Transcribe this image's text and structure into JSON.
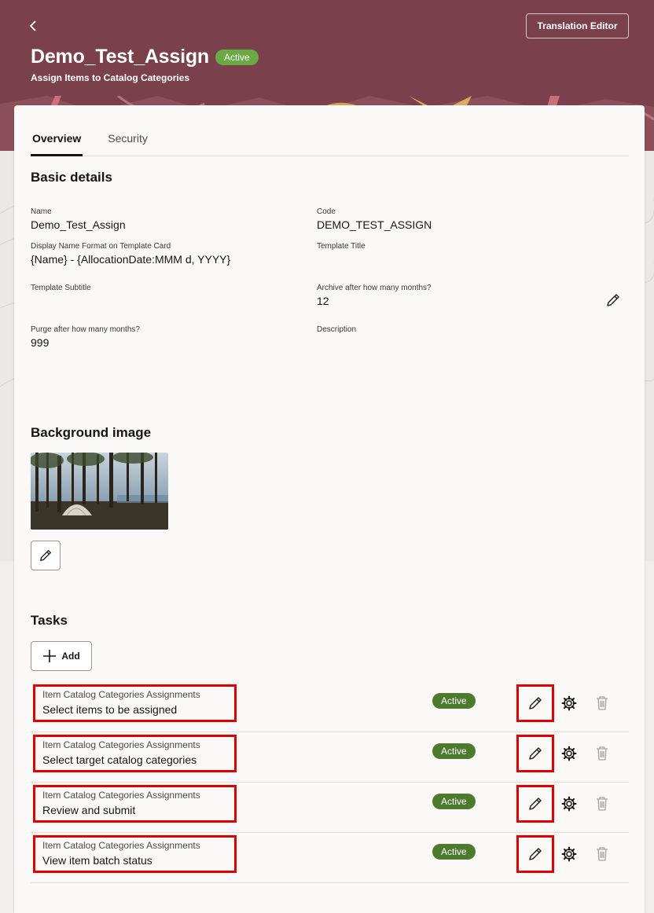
{
  "header": {
    "title": "Demo_Test_Assign",
    "status": "Active",
    "subtitle": "Assign Items to Catalog Categories",
    "translation_button": "Translation Editor",
    "back_icon": "chevron-left-icon"
  },
  "tabs": [
    {
      "label": "Overview",
      "selected": true
    },
    {
      "label": "Security",
      "selected": false
    }
  ],
  "basic_details": {
    "title": "Basic details",
    "fields": {
      "name": {
        "label": "Name",
        "value": "Demo_Test_Assign"
      },
      "code": {
        "label": "Code",
        "value": "DEMO_TEST_ASSIGN"
      },
      "display_name_format": {
        "label": "Display Name Format on Template Card",
        "value": "{Name} - {AllocationDate:MMM d, YYYY}"
      },
      "template_title": {
        "label": "Template Title",
        "value": ""
      },
      "template_subtitle": {
        "label": "Template Subtitle",
        "value": ""
      },
      "archive_months": {
        "label": "Archive after how many months?",
        "value": "12"
      },
      "purge_months": {
        "label": "Purge after how many months?",
        "value": "999"
      },
      "description": {
        "label": "Description",
        "value": ""
      }
    },
    "edit_icon": "pencil-icon"
  },
  "background_image": {
    "title": "Background image",
    "edit_icon": "pencil-icon"
  },
  "tasks": {
    "title": "Tasks",
    "add_label": "Add",
    "items": [
      {
        "category": "Item Catalog Categories Assignments",
        "name": "Select items to be assigned",
        "status": "Active"
      },
      {
        "category": "Item Catalog Categories Assignments",
        "name": "Select target catalog categories",
        "status": "Active"
      },
      {
        "category": "Item Catalog Categories Assignments",
        "name": "Review and submit",
        "status": "Active"
      },
      {
        "category": "Item Catalog Categories Assignments",
        "name": "View item batch status",
        "status": "Active"
      }
    ]
  },
  "colors": {
    "banner": "#7a404c",
    "active_pill_header": "#6aa944",
    "active_pill_row": "#4c7a2e",
    "highlight": "#e00000"
  }
}
